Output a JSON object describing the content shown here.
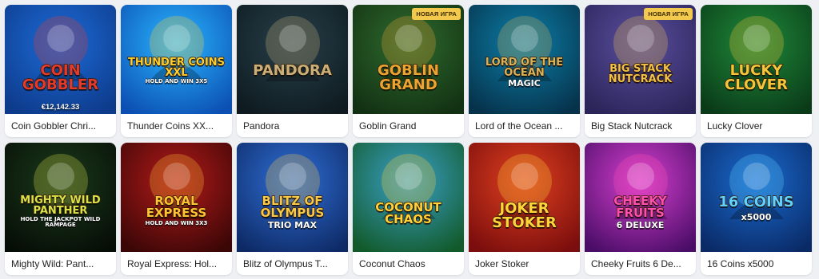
{
  "badge_new": "НОВАЯ ИГРА",
  "games": [
    {
      "title": "Coin Gobbler Chri...",
      "logo": "COIN GOBBLER",
      "jackpot": "€12,142.33",
      "colors": [
        "#1d6bd6",
        "#0d3a8a"
      ],
      "accent": "#e23b2e"
    },
    {
      "title": "Thunder Coins XX...",
      "logo": "THUNDER COINS XXL",
      "sub": "HOLD AND WIN 3X5",
      "colors": [
        "#2ab6ff",
        "#0b4fb3"
      ],
      "accent": "#ffcf2d"
    },
    {
      "title": "Pandora",
      "logo": "PANDORA",
      "colors": [
        "#28404a",
        "#0e1a20"
      ],
      "accent": "#c9b07a"
    },
    {
      "title": "Goblin Grand",
      "logo": "GOBLIN GRAND",
      "is_new": true,
      "colors": [
        "#2f6b2f",
        "#123012"
      ],
      "accent": "#e9a431"
    },
    {
      "title": "Lord of the Ocean ...",
      "logo": "LORD OF THE OCEAN",
      "sub": "MAGIC",
      "colors": [
        "#0c7fa8",
        "#06314a"
      ],
      "accent": "#d9b45a"
    },
    {
      "title": "Big Stack Nutcrack",
      "logo": "BIG STACK NUTCRACK",
      "is_new": true,
      "colors": [
        "#5a4fa0",
        "#2b2458"
      ],
      "accent": "#f0c24a"
    },
    {
      "title": "Lucky Clover",
      "logo": "LUCKY CLOVER",
      "colors": [
        "#1f8a3a",
        "#0a3a18"
      ],
      "accent": "#f3c63a"
    },
    {
      "title": "Mighty Wild: Pant...",
      "logo": "MIGHTY WILD PANTHER",
      "sub": "HOLD THE JACKPOT WILD RAMPAGE",
      "colors": [
        "#1b3a1b",
        "#060d06"
      ],
      "accent": "#d8e34a"
    },
    {
      "title": "Royal Express: Hol...",
      "logo": "ROYAL EXPRESS",
      "sub": "HOLD AND WIN 3X3",
      "colors": [
        "#b31a1a",
        "#3a0606"
      ],
      "accent": "#ffc233"
    },
    {
      "title": "Blitz of Olympus T...",
      "logo": "BLITZ OF OLYMPUS",
      "sub": "TRIO MAX",
      "colors": [
        "#2f6fd6",
        "#0e2a66"
      ],
      "accent": "#f7c948"
    },
    {
      "title": "Coconut Chaos",
      "logo": "COCONUT CHAOS",
      "colors": [
        "#3aa0c9",
        "#125a2a"
      ],
      "accent": "#ffd23a"
    },
    {
      "title": "Joker Stoker",
      "logo": "JOKER STOKER",
      "colors": [
        "#e0401f",
        "#7a0d0d"
      ],
      "accent": "#ffd33a"
    },
    {
      "title": "Cheeky Fruits 6 De...",
      "logo": "CHEEKY FRUITS",
      "sub": "6 DELUXE",
      "colors": [
        "#d63fd0",
        "#4a0d66"
      ],
      "accent": "#ff4fb0"
    },
    {
      "title": "16 Coins x5000",
      "logo": "16 COINS",
      "sub": "x5000",
      "colors": [
        "#1a6bd0",
        "#0a2a66"
      ],
      "accent": "#5fd0ff"
    }
  ]
}
